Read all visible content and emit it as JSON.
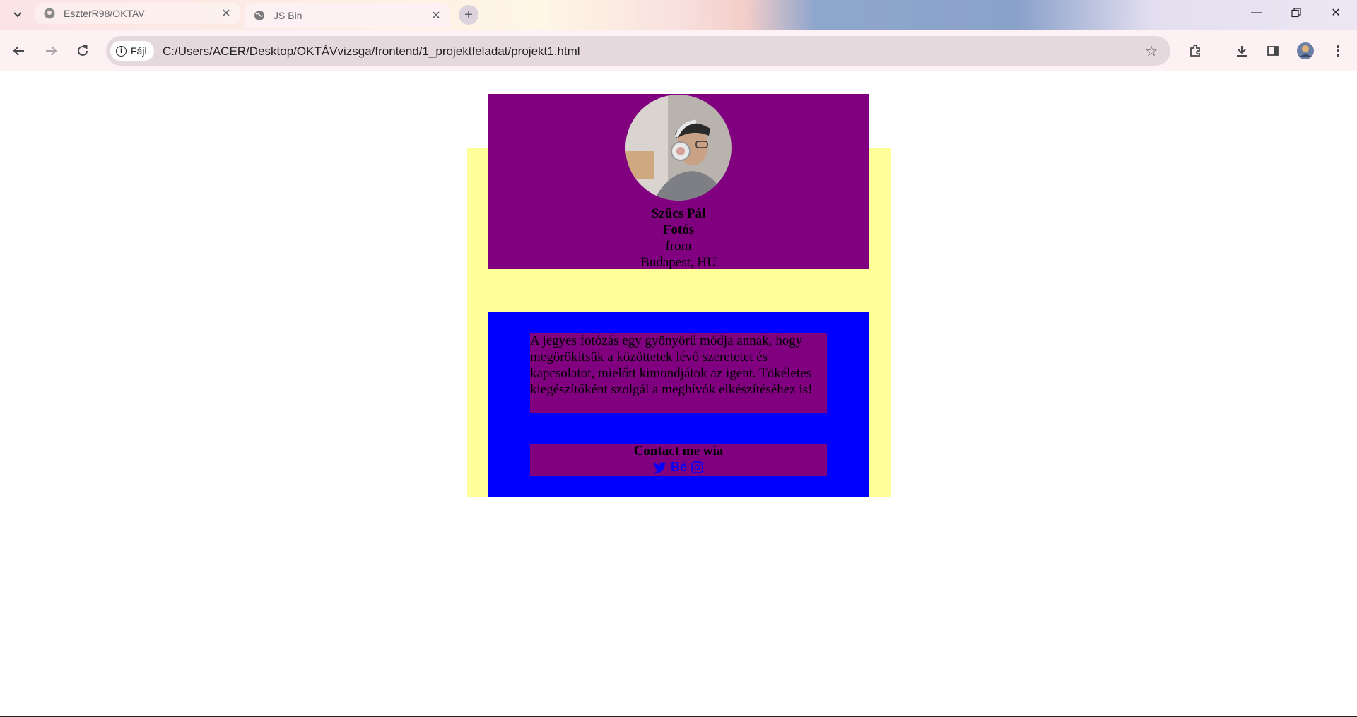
{
  "browser": {
    "tabs": [
      {
        "title": "EszterR98/OKTAV",
        "icon": "github-icon",
        "active": false
      },
      {
        "title": "JS Bin",
        "icon": "globe-icon",
        "active": true
      }
    ],
    "address": {
      "chip_label": "Fájl",
      "url": "C:/Users/ACER/Desktop/OKTÁVvizsga/frontend/1_projektfeladat/projekt1.html"
    }
  },
  "profile": {
    "name": "Szűcs Pál",
    "job": "Fotós",
    "from_label": "from",
    "location": "Budapest, HU"
  },
  "bio": {
    "text": "A jegyes fotózás egy gyönyörű módja annak, hogy megörökítsük a közöttetek lévő szeretetet és kapcsolatot, mielőtt kimondjátok az igent. Tökéletes kiegészítőként szolgál a meghívók elkészítéséhez is!"
  },
  "contact": {
    "heading": "Contact me wia",
    "behance_label": "Bē",
    "social_icons": [
      "twitter-icon",
      "behance-icon",
      "instagram-icon"
    ]
  },
  "colors": {
    "yellow_bg": "#ffff99",
    "purple": "#800080",
    "blue": "#0000ff"
  }
}
